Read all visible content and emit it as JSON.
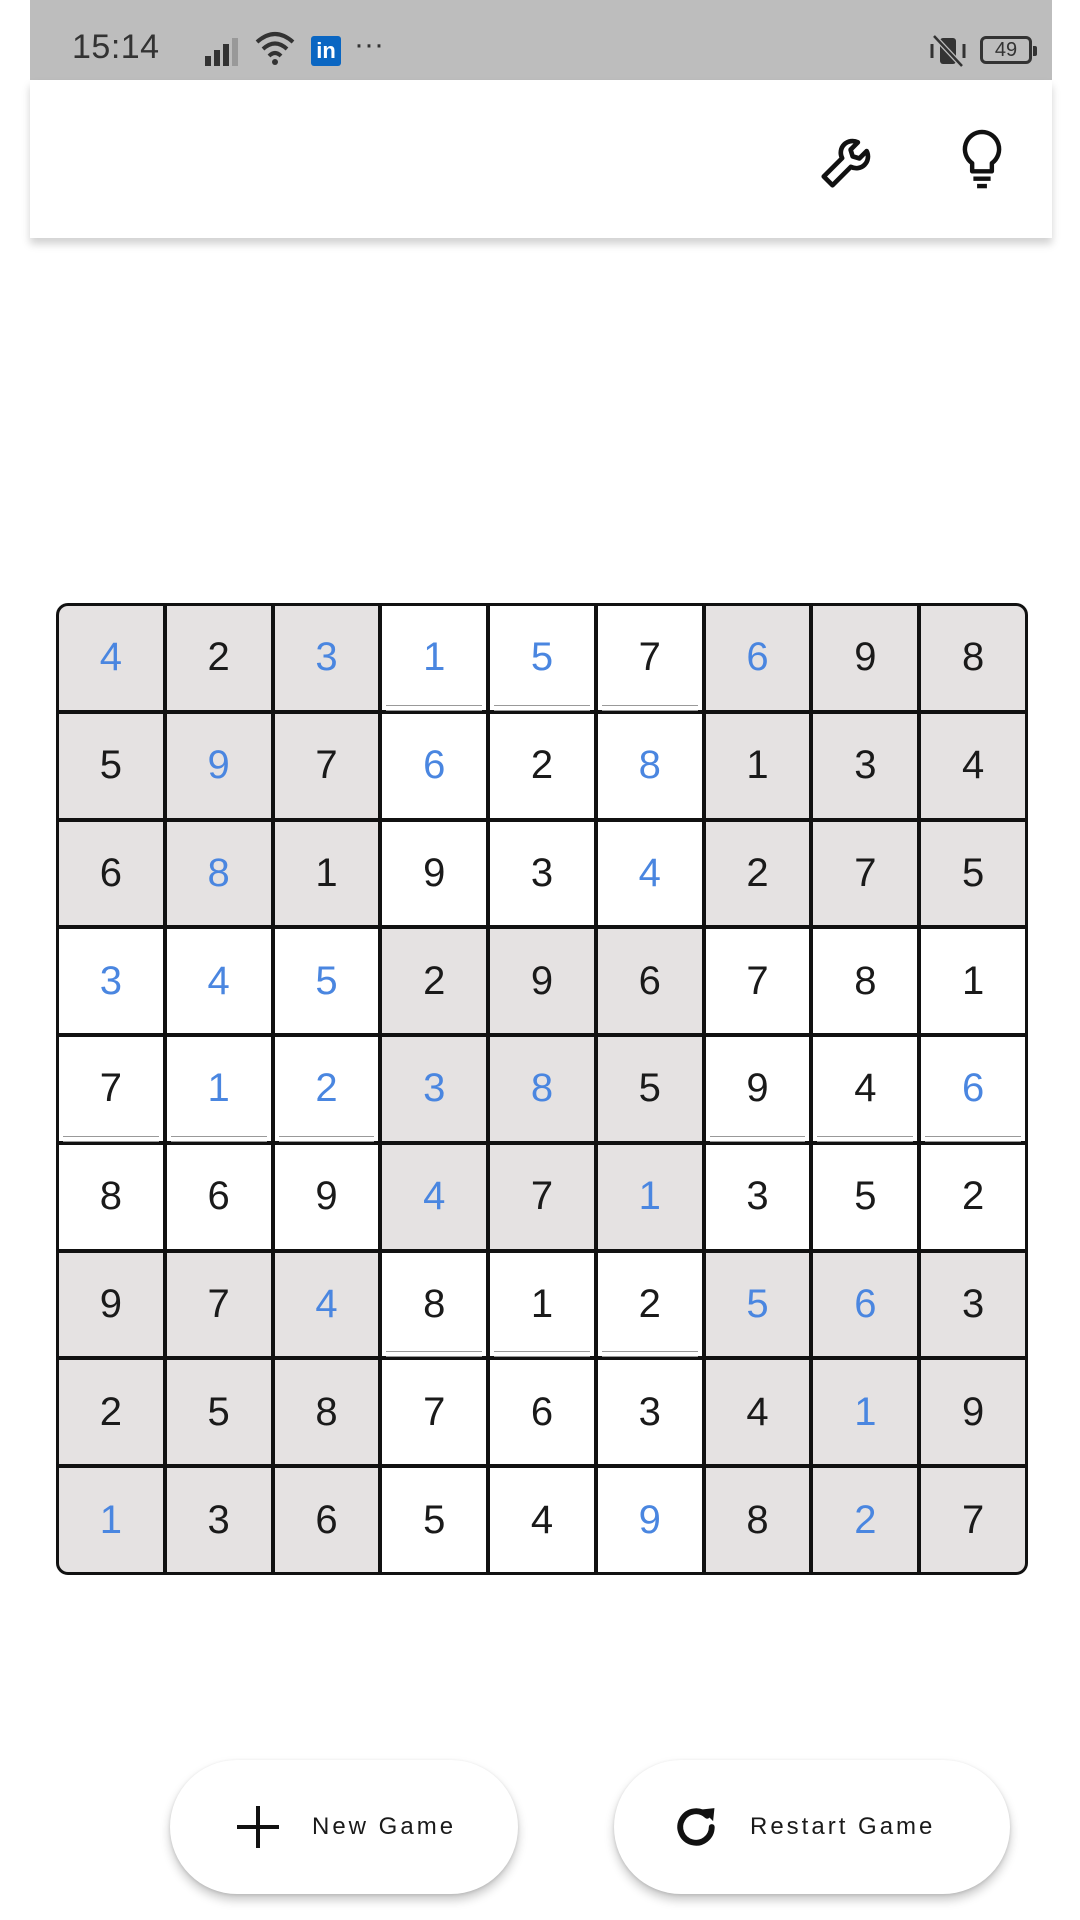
{
  "status_bar": {
    "time": "15:14",
    "battery": "49",
    "more": "···",
    "app_icon": "linkedin-icon",
    "icons": [
      "signal-icon",
      "wifi-icon",
      "linkedin-icon",
      "vibrate-off-icon",
      "battery-icon"
    ]
  },
  "toolbar": {
    "settings_icon": "wrench-icon",
    "hint_icon": "lightbulb-icon"
  },
  "board": {
    "rows": [
      [
        4,
        2,
        3,
        1,
        5,
        7,
        6,
        9,
        8
      ],
      [
        5,
        9,
        7,
        6,
        2,
        8,
        1,
        3,
        4
      ],
      [
        6,
        8,
        1,
        9,
        3,
        4,
        2,
        7,
        5
      ],
      [
        3,
        4,
        5,
        2,
        9,
        6,
        7,
        8,
        1
      ],
      [
        7,
        1,
        2,
        3,
        8,
        5,
        9,
        4,
        6
      ],
      [
        8,
        6,
        9,
        4,
        7,
        1,
        3,
        5,
        2
      ],
      [
        9,
        7,
        4,
        8,
        1,
        2,
        5,
        6,
        3
      ],
      [
        2,
        5,
        8,
        7,
        6,
        3,
        4,
        1,
        9
      ],
      [
        1,
        3,
        6,
        5,
        4,
        9,
        8,
        2,
        7
      ]
    ],
    "entered": [
      [
        1,
        0,
        1,
        1,
        1,
        0,
        1,
        0,
        0
      ],
      [
        0,
        1,
        0,
        1,
        0,
        1,
        0,
        0,
        0
      ],
      [
        0,
        1,
        0,
        0,
        0,
        1,
        0,
        0,
        0
      ],
      [
        1,
        1,
        1,
        0,
        0,
        0,
        0,
        0,
        0
      ],
      [
        0,
        1,
        1,
        1,
        1,
        0,
        0,
        0,
        1
      ],
      [
        0,
        0,
        0,
        1,
        0,
        1,
        0,
        0,
        0
      ],
      [
        0,
        0,
        1,
        0,
        0,
        0,
        1,
        1,
        0
      ],
      [
        0,
        0,
        0,
        0,
        0,
        0,
        0,
        1,
        0
      ],
      [
        1,
        0,
        0,
        0,
        0,
        1,
        0,
        1,
        0
      ]
    ],
    "given_color": "#1a1a1a",
    "entered_color": "#4a86e0",
    "shaded_color": "#e5e2e2"
  },
  "actions": {
    "new_game_label": "New Game",
    "new_game_icon": "plus-icon",
    "restart_label": "Restart Game",
    "restart_icon": "restart-icon"
  }
}
